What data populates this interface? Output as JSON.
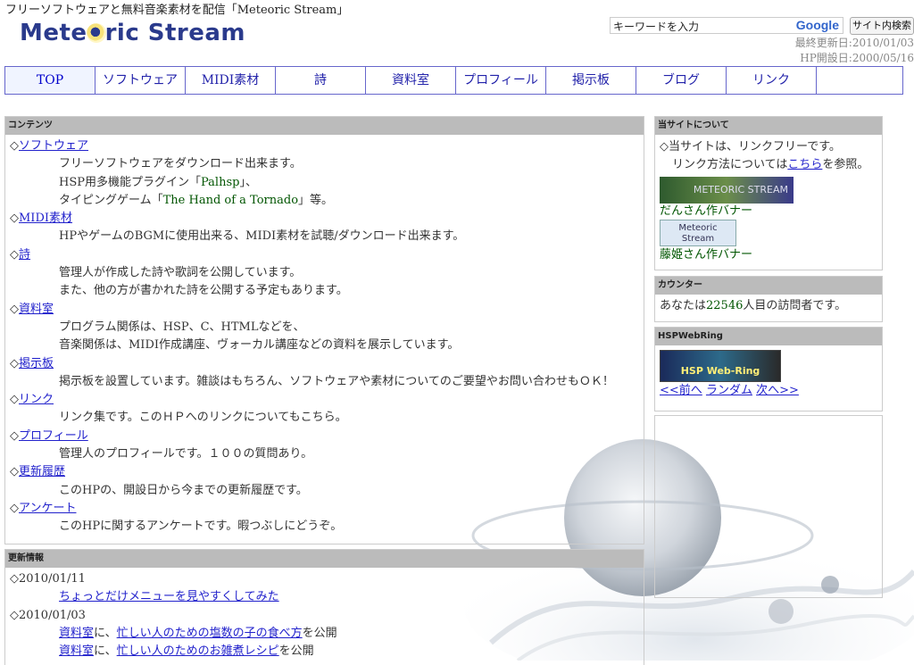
{
  "header": {
    "tagline": "フリーソフトウェアと無料音楽素材を配信「Meteoric Stream」",
    "logo_left": "Mete",
    "logo_right": "ric Stream",
    "search_placeholder": "キーワードを入力",
    "search_brand": "Google",
    "search_button": "サイト内検索",
    "last_updated": "最終更新日:2010/01/03",
    "opened": "HP開設日:2000/05/16"
  },
  "nav": [
    "TOP",
    "ソフトウェア",
    "MIDI素材",
    "詩",
    "資料室",
    "プロフィール",
    "掲示板",
    "ブログ",
    "リンク"
  ],
  "contents": {
    "heading": "コンテンツ",
    "sections": [
      {
        "title": "ソフトウェア",
        "lines": [
          "フリーソフトウェアをダウンロード出来ます。"
        ]
      },
      {
        "title": "MIDI素材",
        "lines": [
          "HPやゲームのBGMに使用出来る、MIDI素材を試聴/ダウンロード出来ます。"
        ]
      },
      {
        "title": "詩",
        "lines": [
          "管理人が作成した詩や歌詞を公開しています。",
          "また、他の方が書かれた詩を公開する予定もあります。"
        ]
      },
      {
        "title": "資料室",
        "lines": [
          "プログラム関係は、HSP、C、HTMLなどを、",
          "音楽関係は、MIDI作成講座、ヴォーカル講座などの資料を展示しています。"
        ]
      },
      {
        "title": "掲示板",
        "lines": [
          "掲示板を設置しています。雑談はもちろん、ソフトウェアや素材についてのご要望やお問い合わせもＯＫ！"
        ]
      },
      {
        "title": "リンク",
        "lines": [
          "リンク集です。このＨＰへのリンクについてもこちら。"
        ]
      },
      {
        "title": "プロフィール",
        "lines": [
          "管理人のプロフィールです。１００の質問あり。"
        ]
      },
      {
        "title": "更新履歴",
        "lines": [
          "このHPの、開設日から今までの更新履歴です。"
        ]
      },
      {
        "title": "アンケート",
        "lines": [
          "このHPに関するアンケートです。暇つぶしにどうぞ。"
        ]
      }
    ],
    "software_extra": {
      "l2_pre": "HSP用多機能プラグイン「",
      "l2_link": "Palhsp",
      "l2_post": "」、",
      "l3_pre": "タイピングゲーム「",
      "l3_link": "The Hand of a Tornado",
      "l3_post": "」等。"
    }
  },
  "updates": {
    "heading": "更新情報",
    "entries": [
      {
        "date": "◇2010/01/11",
        "link": "ちょっとだけメニューを見やすくしてみた"
      },
      {
        "date": "◇2010/01/03"
      }
    ],
    "sub": [
      {
        "pre_link": "資料室",
        "mid": "に、",
        "link": "忙しい人のための塩数の子の食べ方",
        "post": "を公開"
      },
      {
        "pre_link": "資料室",
        "mid": "に、",
        "link": "忙しい人のためのお雑煮レシピ",
        "post": "を公開"
      }
    ]
  },
  "about": {
    "heading": "当サイトについて",
    "line1": "◇当サイトは、リンクフリーです。",
    "line2_pre": "リンク方法については",
    "line2_link": "こちら",
    "line2_post": "を参照。",
    "banner1_text": "METEORIC STREAM",
    "banner1_caption": "だんさん作バナー",
    "banner2_text_1": "Meteoric",
    "banner2_text_2": "Stream",
    "banner2_caption": "藤姫さん作バナー"
  },
  "counter": {
    "heading": "カウンター",
    "pre": "あなたは",
    "count": "22546",
    "post": "人目の訪問者です。"
  },
  "webring": {
    "heading": "HSPWebRing",
    "banner_text": "HSP Web-Ring",
    "prev": "<<前へ",
    "random": "ランダム",
    "next": "次へ>>"
  }
}
